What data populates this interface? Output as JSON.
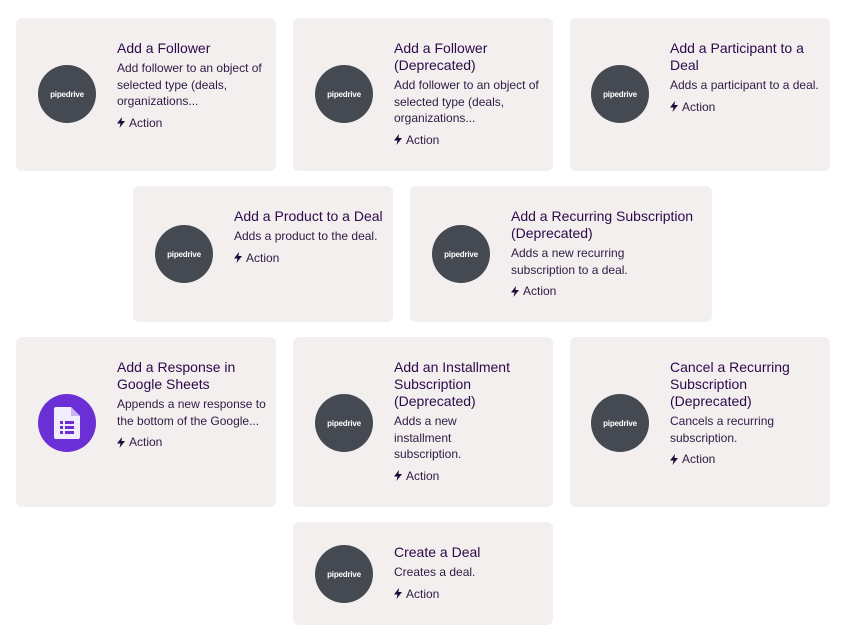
{
  "cards": [
    {
      "logo": "pipedrive",
      "title": "Add a Follower",
      "desc": "Add follower to an object of selected type (deals, organizations...",
      "badge": "Action"
    },
    {
      "logo": "pipedrive",
      "title": "Add a Follower (Deprecated)",
      "desc": "Add follower to an object of selected type (deals, organizations...",
      "badge": "Action"
    },
    {
      "logo": "pipedrive",
      "title": "Add a Participant to a Deal",
      "desc": "Adds a participant to a deal.",
      "badge": "Action"
    },
    {
      "logo": "pipedrive",
      "title": "Add a Product to a Deal",
      "desc": "Adds a product to the deal.",
      "badge": "Action"
    },
    {
      "logo": "pipedrive",
      "title": "Add a Recurring Subscription (Deprecated)",
      "desc": "Adds a new recurring subscription to a deal.",
      "badge": "Action"
    },
    {
      "logo": "google-sheets-icon",
      "title": "Add a Response in Google Sheets",
      "desc": "Appends a new response to the bottom of the Google...",
      "badge": "Action"
    },
    {
      "logo": "pipedrive",
      "title": "Add an Installment Subscription (Deprecated)",
      "desc": "Adds a new installment subscription.",
      "badge": "Action"
    },
    {
      "logo": "pipedrive",
      "title": "Cancel a Recurring Subscription (Deprecated)",
      "desc": "Cancels a recurring subscription.",
      "badge": "Action"
    },
    {
      "logo": "pipedrive",
      "title": "Create a Deal",
      "desc": "Creates a deal.",
      "badge": "Action"
    }
  ],
  "logo_text": "pipedrive",
  "colors": {
    "card_bg": "#f3efee",
    "pipedrive": "#454a52",
    "gsheets": "#6b2fd6",
    "text": "#2a0a4a"
  }
}
